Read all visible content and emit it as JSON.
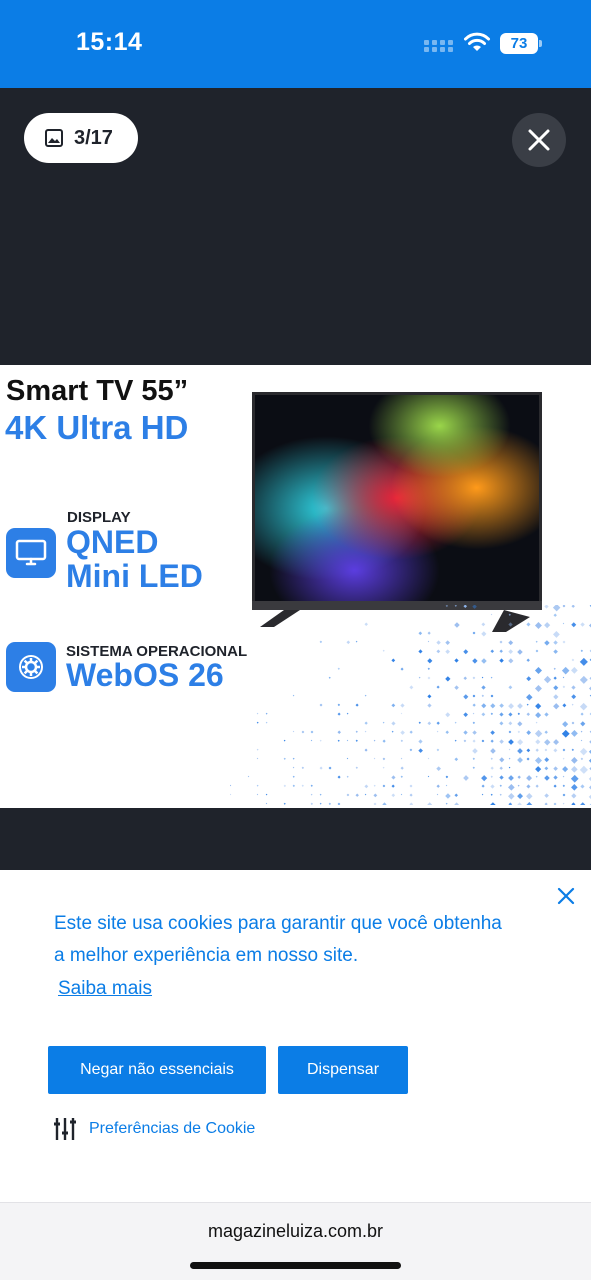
{
  "status_bar": {
    "time": "15:14",
    "battery_level": "73",
    "icons": [
      "signal-icon",
      "wifi-icon",
      "battery-icon"
    ],
    "background_color": "#0b7de6"
  },
  "gallery": {
    "counter": "3/17",
    "icons": [
      "image-icon",
      "close-icon"
    ],
    "product_image": {
      "title_line1": "Smart TV 55”",
      "title_line2": "4K Ultra HD",
      "features": [
        {
          "label": "DISPLAY",
          "value_line1": "QNED",
          "value_line2": "Mini LED",
          "icon": "monitor-icon"
        },
        {
          "label": "SISTEMA OPERACIONAL",
          "value_line1": "WebOS 26",
          "icon": "gear-icon"
        }
      ],
      "accent_color": "#2d7fe6"
    }
  },
  "cookie_banner": {
    "message": "Este site usa cookies para garantir que você obtenha a melhor experiência em nosso site.",
    "learn_more": "Saiba mais",
    "deny_button": "Negar não essenciais",
    "dismiss_button": "Dispensar",
    "preferences": "Preferências de Cookie",
    "icons": [
      "close-icon",
      "sliders-icon"
    ],
    "accent_color": "#0b7de6"
  },
  "browser": {
    "url": "magazineluiza.com.br"
  }
}
